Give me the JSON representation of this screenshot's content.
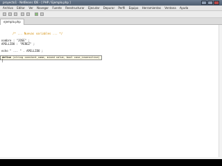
{
  "window": {
    "title": "proyecto1 - NetBeans IDE - [ PHP / Ejemplo.php ]"
  },
  "menubar": {
    "items": [
      "Archivo",
      "Editar",
      "Ver",
      "Navegar",
      "Fuente",
      "Reestructurar",
      "Ejecutar",
      "Depurar",
      "Perfil",
      "Equipo",
      "Herramientas",
      "Ventana",
      "Ayuda"
    ]
  },
  "tabs": [
    {
      "label": "ejemplo.php"
    }
  ],
  "editor": {
    "lines": [
      "/* ... Nuevas variables ... */",
      "",
      "nombre : \"JOSE\" ;",
      "APELLIDO : \"PEREZ\" ;",
      "",
      "echo \" ... \" . APELLIDO ;"
    ],
    "comment_line": "/* ... Nuevas variables ... */",
    "autocomplete": {
      "prefix": "define",
      "text": "(string constant_name, mixed value, bool case_insensitive)"
    },
    "cursor": "|"
  }
}
